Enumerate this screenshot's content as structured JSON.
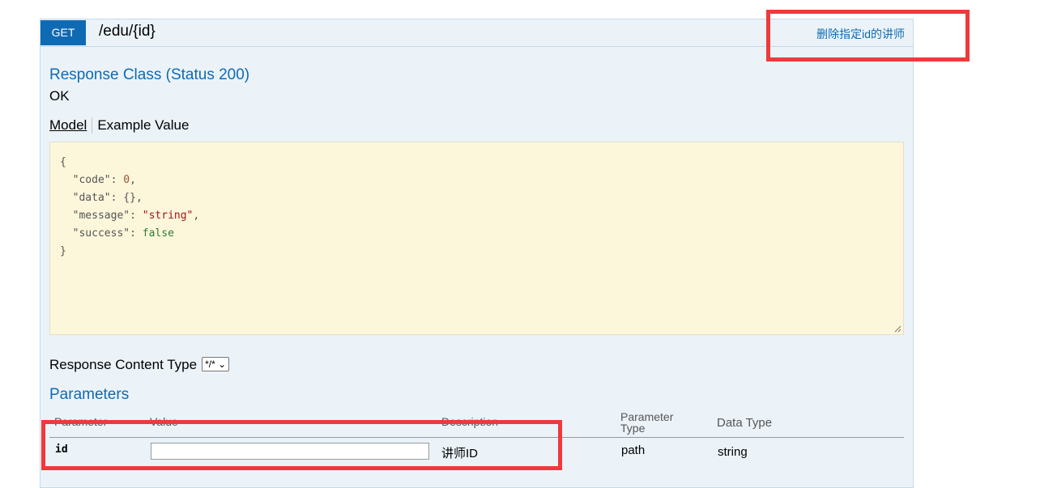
{
  "operation": {
    "method": "GET",
    "path": "/edu/{id}",
    "summary": "删除指定id的讲师"
  },
  "response": {
    "class_title": "Response Class (Status 200)",
    "status_text": "OK",
    "tabs": [
      "Model",
      "Example Value"
    ],
    "example_json": [
      {
        "key": "\"code\"",
        "value": "0",
        "kind": "number",
        "comma": true
      },
      {
        "key": "\"data\"",
        "value": "{}",
        "kind": "plain",
        "comma": true
      },
      {
        "key": "\"message\"",
        "value": "\"string\"",
        "kind": "string",
        "comma": true
      },
      {
        "key": "\"success\"",
        "value": "false",
        "kind": "bool",
        "comma": false
      }
    ],
    "content_type_label": "Response Content Type",
    "content_type_value": "*/*"
  },
  "parameters": {
    "title": "Parameters",
    "headers": {
      "parameter": "Parameter",
      "value": "Value",
      "description": "Description",
      "parameter_type": [
        "Parameter",
        "Type"
      ],
      "data_type": "Data Type"
    },
    "rows": [
      {
        "name": "id",
        "value": "",
        "description": "讲师ID",
        "param_type": "path",
        "data_type": "string"
      }
    ]
  },
  "colors": {
    "accent": "#0f6ab4",
    "panel_bg": "#ebf3f9",
    "sample_bg": "#fcf6db",
    "annotation_red": "#f0393c"
  }
}
